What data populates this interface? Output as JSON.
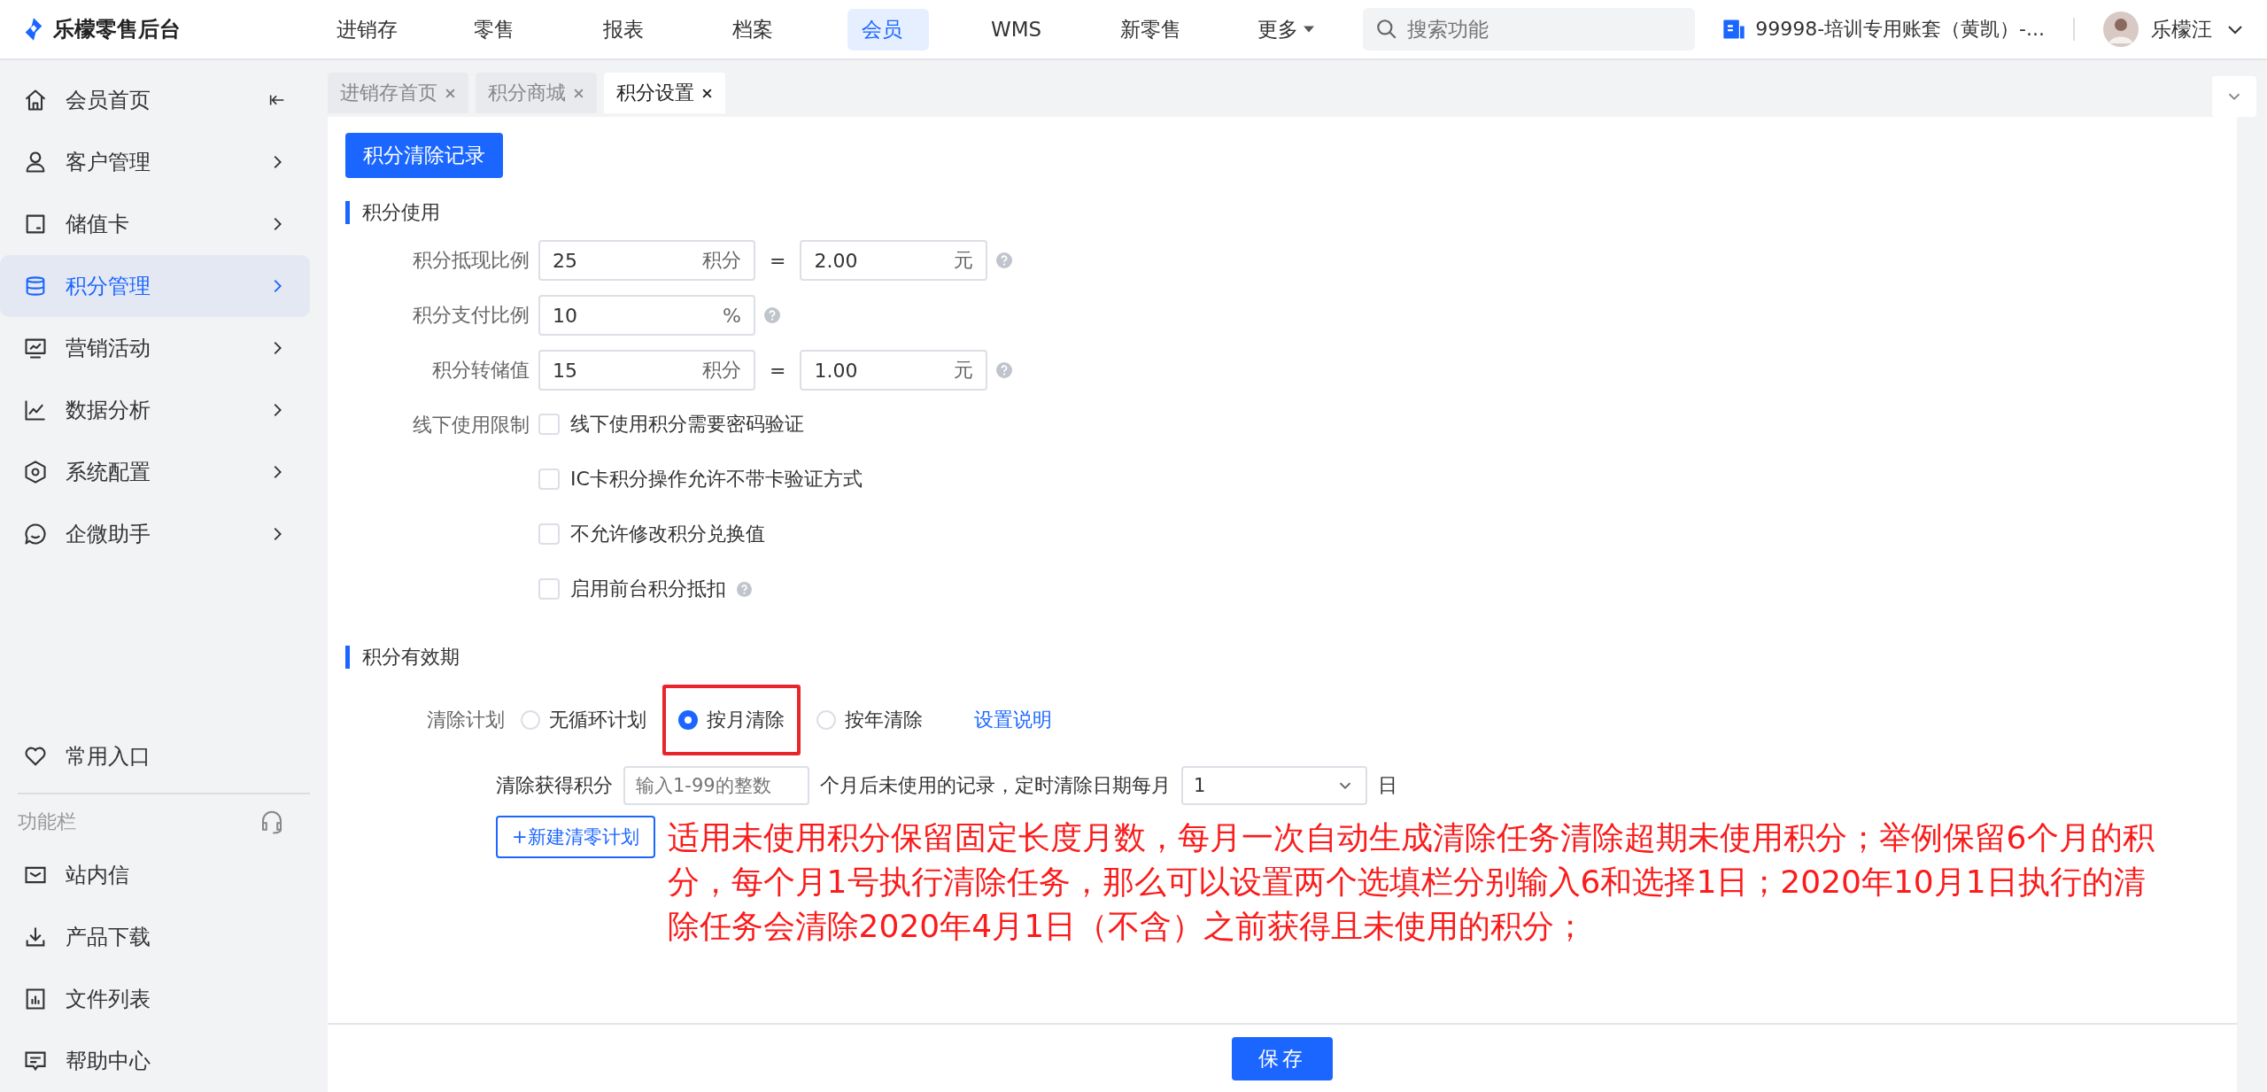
{
  "app": {
    "logo": "乐檬零售后台"
  },
  "nav": [
    {
      "label": "进销存",
      "selected": false,
      "caret": false
    },
    {
      "label": "零售",
      "selected": false,
      "caret": false
    },
    {
      "label": "报表",
      "selected": false,
      "caret": false
    },
    {
      "label": "档案",
      "selected": false,
      "caret": false
    },
    {
      "label": "会员",
      "selected": true,
      "caret": false
    },
    {
      "label": "WMS",
      "selected": false,
      "caret": false
    },
    {
      "label": "新零售",
      "selected": false,
      "caret": false
    },
    {
      "label": "更多",
      "selected": false,
      "caret": true
    }
  ],
  "search": {
    "placeholder": "搜索功能"
  },
  "account": "99998-培训专用账套（黄凯）-...",
  "user": {
    "name": "乐檬汪"
  },
  "sidebar": {
    "items": [
      {
        "label": "会员首页",
        "kind": "collapse",
        "selected": false
      },
      {
        "label": "客户管理",
        "kind": "submenu",
        "selected": false
      },
      {
        "label": "储值卡",
        "kind": "submenu",
        "selected": false
      },
      {
        "label": "积分管理",
        "kind": "submenu",
        "selected": true
      },
      {
        "label": "营销活动",
        "kind": "submenu",
        "selected": false
      },
      {
        "label": "数据分析",
        "kind": "submenu",
        "selected": false
      },
      {
        "label": "系统配置",
        "kind": "submenu",
        "selected": false
      },
      {
        "label": "企微助手",
        "kind": "submenu",
        "selected": false
      }
    ],
    "shortcut": "常用入口",
    "toolbar_title": "功能栏",
    "toolbar_items": [
      "站内信",
      "产品下载",
      "文件列表",
      "帮助中心"
    ]
  },
  "tabs": [
    {
      "label": "进销存首页",
      "selected": false
    },
    {
      "label": "积分商城",
      "selected": false
    },
    {
      "label": "积分设置",
      "selected": true
    }
  ],
  "record_button": "积分清除记录",
  "points_use": {
    "title": "积分使用",
    "rows": [
      {
        "kind": "pair",
        "label": "积分抵现比例",
        "value": "25",
        "unit": "积分",
        "equals": "=",
        "value2": "2.00",
        "unit2": "元"
      },
      {
        "kind": "single",
        "label": "积分支付比例",
        "value": "10",
        "unit": "%"
      },
      {
        "kind": "pair",
        "label": "积分转储值",
        "value": "15",
        "unit": "积分",
        "equals": "=",
        "value2": "1.00",
        "unit2": "元"
      }
    ],
    "limit_label": "线下使用限制",
    "options": [
      {
        "label": "线下使用积分需要密码验证",
        "checked": false,
        "help": false
      },
      {
        "label": "IC卡积分操作允许不带卡验证方式",
        "checked": false,
        "help": false
      },
      {
        "label": "不允许修改积分兑换值",
        "checked": false,
        "help": false
      },
      {
        "label": "启用前台积分抵扣",
        "checked": false,
        "help": true
      }
    ]
  },
  "validity": {
    "title": "积分有效期",
    "plan_label": "清除计划",
    "plans": [
      {
        "label": "无循环计划",
        "selected": false,
        "highlighted": false
      },
      {
        "label": "按月清除",
        "selected": true,
        "highlighted": true
      },
      {
        "label": "按年清除",
        "selected": false,
        "highlighted": false
      }
    ],
    "help_link": "设置说明",
    "rule_label": "清除获得积分",
    "rule_placeholder": "输入1-99的整数",
    "rule_middle": "个月后未使用的记录，定时清除日期每月",
    "day_value": "1",
    "day_unit": "日",
    "new_plan_button": "+新建清零计划",
    "note": "适用未使用积分保留固定长度月数，每月一次自动生成清除任务清除超期未使用积分；举例保留6个月的积分，每个月1号执行清除任务，那么可以设置两个选填栏分别输入6和选择1日；2020年10月1日执行的清除任务会清除2020年4月1日（不含）之前获得且未使用的积分；"
  },
  "save_button": "保存"
}
